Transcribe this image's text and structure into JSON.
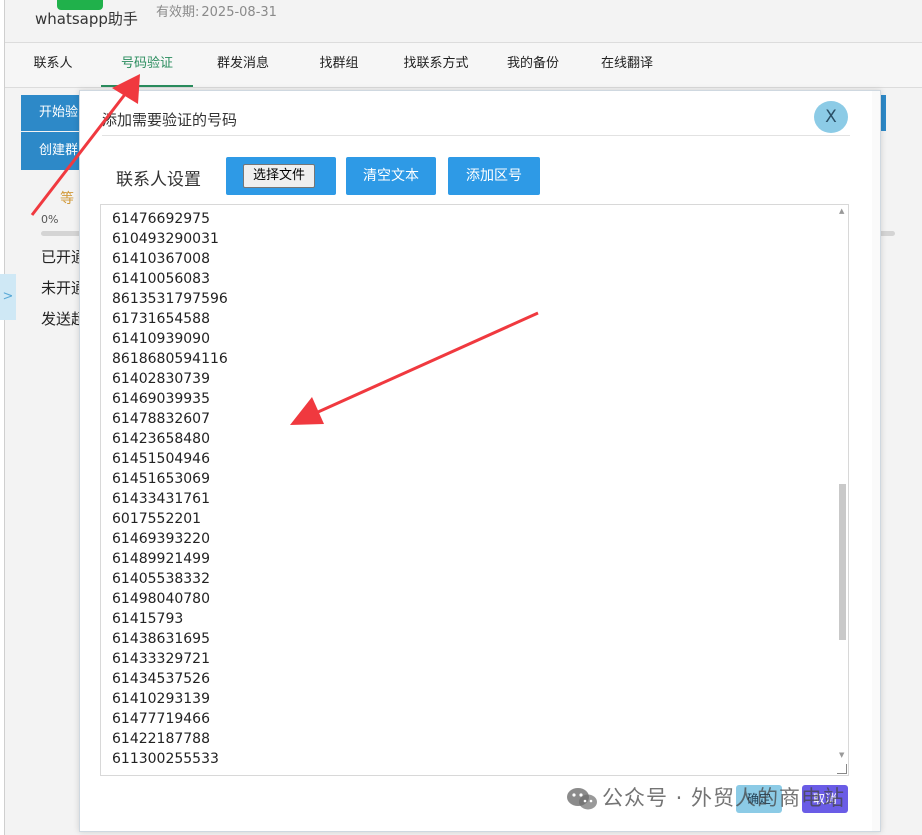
{
  "app": {
    "name": "whatsapp助手",
    "expiry_label": "有效期:",
    "expiry_date": "2025-08-31",
    "brand_color": "#20b14b"
  },
  "tabs": [
    {
      "label": "联系人",
      "active": false
    },
    {
      "label": "号码验证",
      "active": true
    },
    {
      "label": "群发消息",
      "active": false
    },
    {
      "label": "找群组",
      "active": false
    },
    {
      "label": "找联系方式",
      "active": false
    },
    {
      "label": "我的备份",
      "active": false
    },
    {
      "label": "在线翻译",
      "active": false
    }
  ],
  "background": {
    "button1": "开始验",
    "button2": "创建群",
    "waiting": "等",
    "progress_label": "0%",
    "progress": 0,
    "lines": [
      "已开通",
      "未开通",
      "发送超"
    ],
    "side_toggle": ">"
  },
  "modal": {
    "title": "添加需要验证的号码",
    "close_label": "X",
    "settings_label": "联系人设置",
    "file_button": "选择文件",
    "clear_button": "清空文本",
    "area_code_button": "添加区号",
    "numbers": [
      "61476692975",
      "610493290031",
      "61410367008",
      "61410056083",
      "8613531797596",
      "61731654588",
      "61410939090",
      "8618680594116",
      "61402830739",
      "61469039935",
      "61478832607",
      "61423658480",
      "61451504946",
      "61451653069",
      "61433431761",
      "6017552201",
      "61469393220",
      "61489921499",
      "61405538332",
      "61498040780",
      "61415793",
      "61438631695",
      "61433329721",
      "61434537526",
      "61410293139",
      "61477719466",
      "61422187788",
      "611300255533"
    ],
    "ok_button": "确定",
    "cancel_button": "取消"
  },
  "colors": {
    "primary_blue": "#2e9ae6",
    "active_tab": "#2a8d5e",
    "cancel": "#6a5ce6",
    "annotation_arrow": "#f0393f"
  },
  "watermark": {
    "text": "公众号 · 外贸人的商电站"
  }
}
